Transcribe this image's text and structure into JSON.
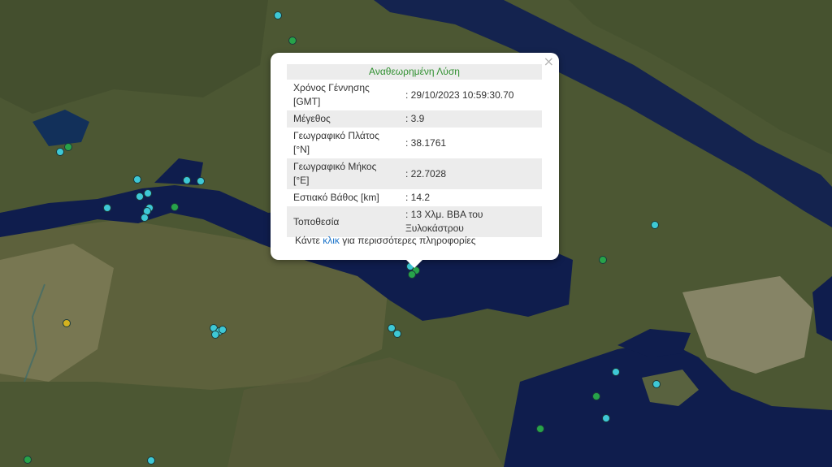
{
  "popup": {
    "title": "Αναθεωρημένη Λύση",
    "close_glyph": "×",
    "rows": [
      {
        "label": "Χρόνος Γέννησης [GMT]",
        "value": ": 29/10/2023 10:59:30.70"
      },
      {
        "label": "Μέγεθος",
        "value": ": 3.9"
      },
      {
        "label": "Γεωγραφικό Πλάτος [°N]",
        "value": ": 38.1761"
      },
      {
        "label": "Γεωγραφικό Μήκος [°E]",
        "value": ": 22.7028"
      },
      {
        "label": "Εστιακό Βάθος [km]",
        "value": ": 14.2"
      },
      {
        "label": "Τοποθεσία",
        "value": ": 13 Χλμ. ΒΒΑ του Ξυλοκάστρου"
      }
    ],
    "more_prefix": "Κάντε",
    "more_link": "κλικ",
    "more_suffix": "για περισσότερες πληροφορίες"
  },
  "colors": {
    "cyan": "#3ec8d6",
    "green": "#27a34a",
    "yellow": "#d4b21f",
    "sea": "#0e1f4e",
    "land": "#4e5a36"
  }
}
